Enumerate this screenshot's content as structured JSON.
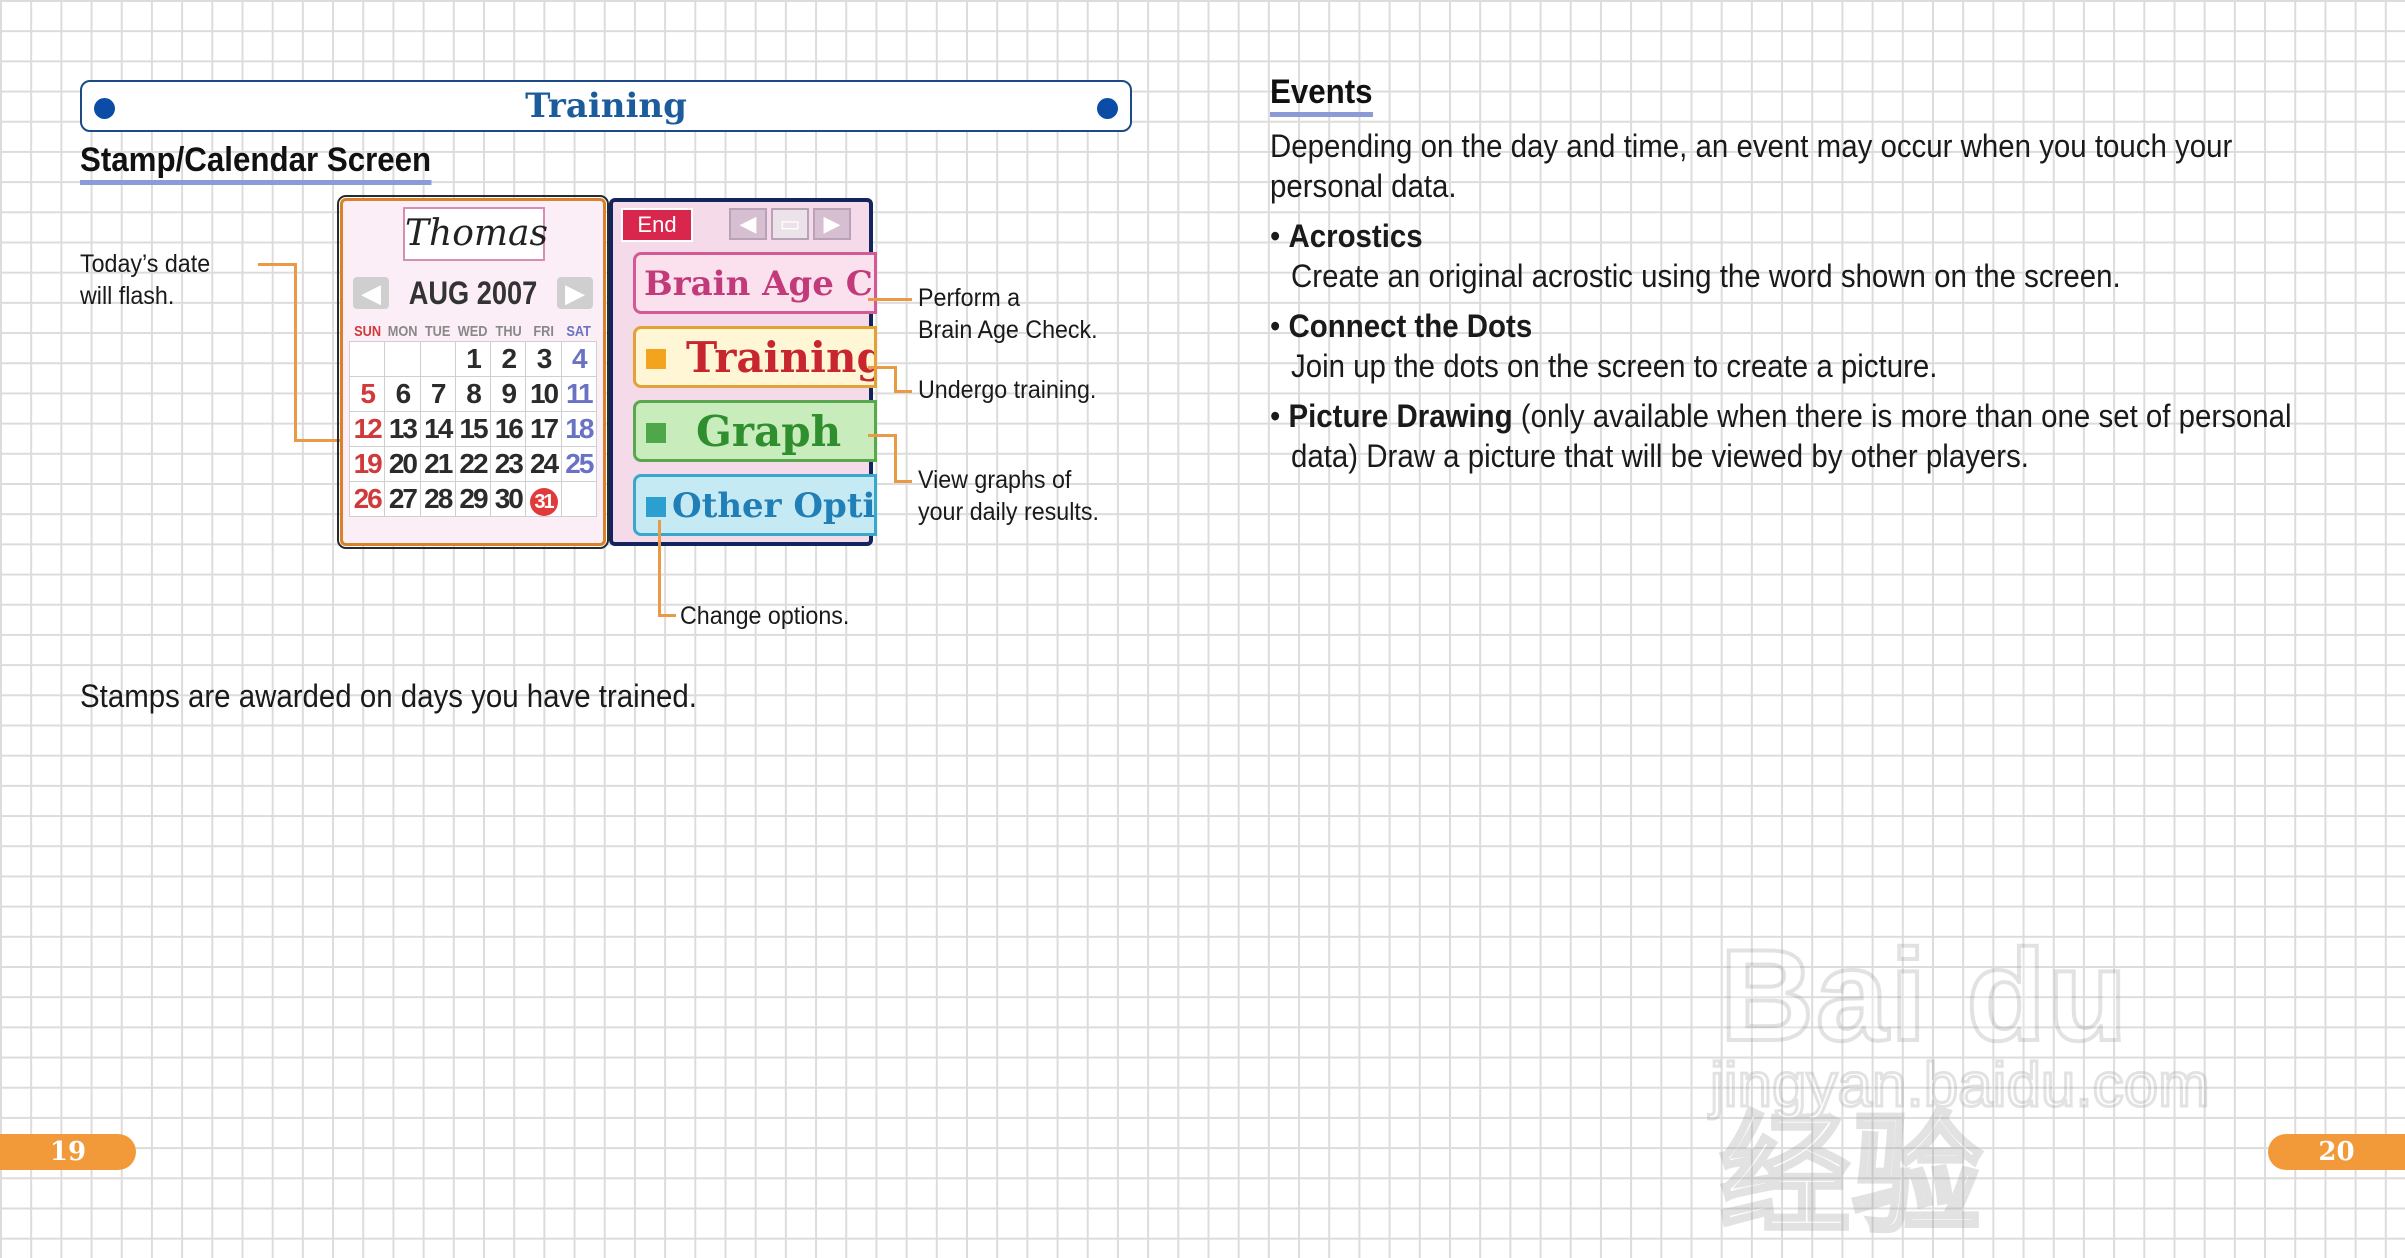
{
  "left_page": {
    "banner_title": "Training",
    "section_heading": "Stamp/Calendar Screen",
    "callouts": {
      "todays_date": [
        "Today’s date",
        "will flash."
      ],
      "brain_age": [
        "Perform a",
        "Brain Age Check."
      ],
      "training": "Undergo training.",
      "graph": [
        "View graphs of",
        "your daily results."
      ],
      "options": "Change options."
    },
    "caption": "Stamps are awarded on days you have trained.",
    "page_number": "19"
  },
  "screen_left": {
    "name": "Thomas",
    "month": "AUG 2007",
    "weekdays": [
      "SUN",
      "MON",
      "TUE",
      "WED",
      "THU",
      "FRI",
      "SAT"
    ],
    "weeks": [
      [
        "",
        "",
        "",
        "1",
        "2",
        "3",
        "4"
      ],
      [
        "5",
        "6",
        "7",
        "8",
        "9",
        "10",
        "11"
      ],
      [
        "12",
        "13",
        "14",
        "15",
        "16",
        "17",
        "18"
      ],
      [
        "19",
        "20",
        "21",
        "22",
        "23",
        "24",
        "25"
      ],
      [
        "26",
        "27",
        "28",
        "29",
        "30",
        "31",
        ""
      ]
    ],
    "stamped_day": "31"
  },
  "screen_right": {
    "end_label": "End",
    "menu": [
      {
        "label": "Brain Age Check",
        "text_color": "#c23a7a",
        "bg": "#fbe0ee",
        "border": "#d45a96"
      },
      {
        "label": "Training",
        "text_color": "#c8262e",
        "bg": "#fff6d6",
        "border": "#e3a13a"
      },
      {
        "label": "Graph",
        "text_color": "#2f8f2f",
        "bg": "#c8ecbc",
        "border": "#5aa84e"
      },
      {
        "label": "Other Options",
        "text_color": "#1f7fb6",
        "bg": "#c6eaf4",
        "border": "#3aa7cc"
      }
    ]
  },
  "right_page": {
    "heading": "Events",
    "intro": [
      "Depending on the day and time, an event may occur when you touch your",
      "personal data."
    ],
    "bullets": [
      {
        "title": "Acrostics",
        "lines": [
          "Create an original acrostic using the word shown on the screen."
        ]
      },
      {
        "title": "Connect the Dots",
        "lines": [
          "Join up the dots on the screen to create a picture."
        ]
      },
      {
        "title": "Picture Drawing",
        "inline": " (only available when there is more than one set of personal",
        "lines": [
          "data) Draw a picture that will be viewed by other players."
        ]
      }
    ],
    "page_number": "20"
  },
  "watermark": {
    "logo_text": "Bai du 经验",
    "url": "jingyan.baidu.com"
  },
  "colors": {
    "accent_blue": "#1d4a86",
    "leader_orange": "#e89a46",
    "page_tab_orange": "#f29a3a",
    "heading_underline": "#8c9ad8"
  }
}
